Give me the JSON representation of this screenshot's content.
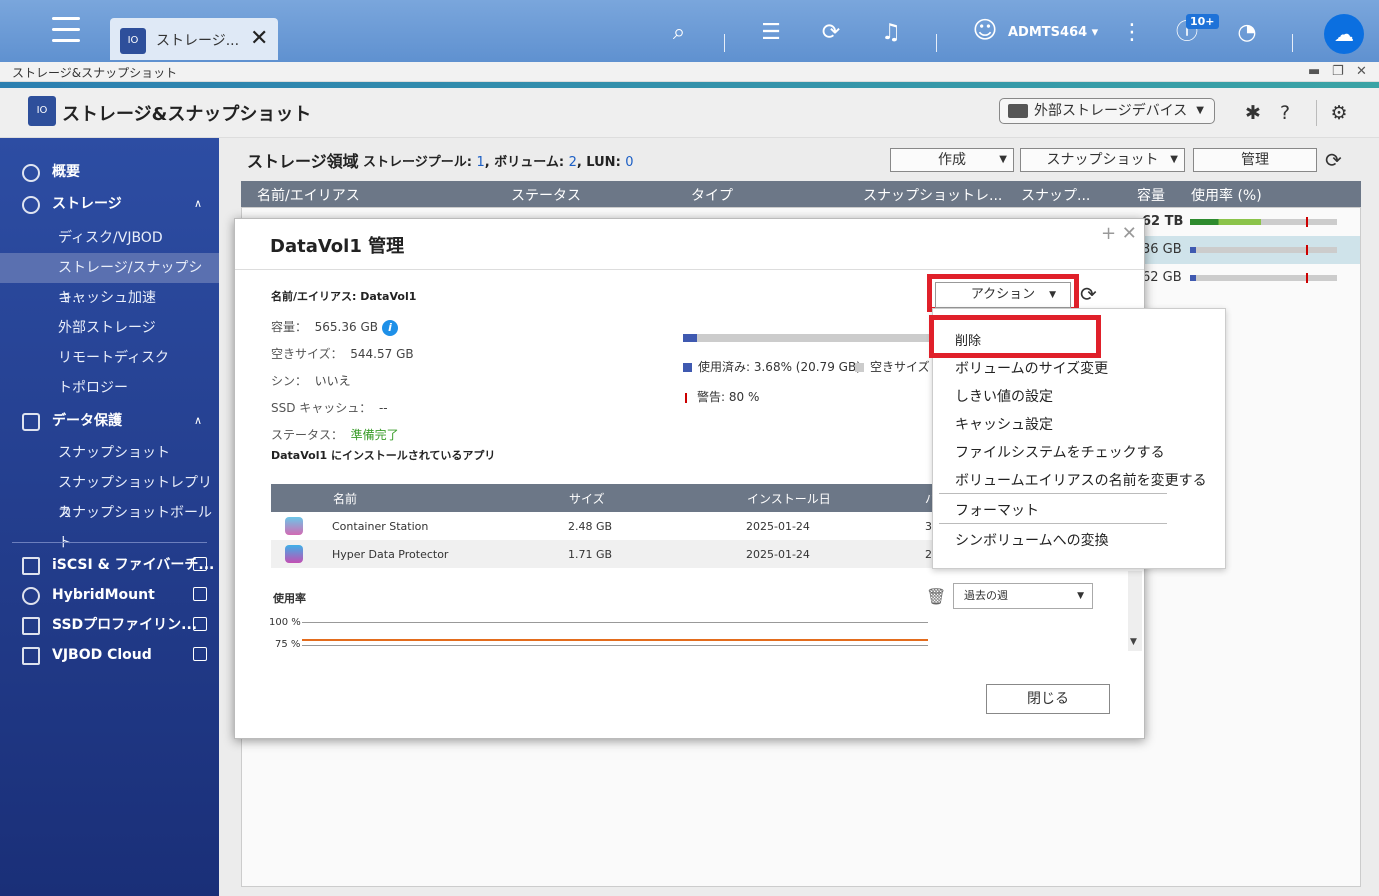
{
  "taskbar": {
    "tab_label": "ストレージ...",
    "tab_close": "✕",
    "username": "ADMTS464 ▾",
    "notification_badge": "10+"
  },
  "window": {
    "title": "ストレージ&スナップショット",
    "minimize": "▬",
    "restore": "❐",
    "close": "✕"
  },
  "header": {
    "app_title": "ストレージ&スナップショット",
    "external_devices": "外部ストレージデバイス"
  },
  "sidebar": {
    "items": [
      {
        "label": "概要"
      },
      {
        "label": "ストレージ"
      },
      {
        "label": "ディスク/VJBOD"
      },
      {
        "label": "ストレージ/スナップショ..."
      },
      {
        "label": "キャッシュ加速"
      },
      {
        "label": "外部ストレージ"
      },
      {
        "label": "リモートディスク"
      },
      {
        "label": "トポロジー"
      },
      {
        "label": "データ保護"
      },
      {
        "label": "スナップショット"
      },
      {
        "label": "スナップショットレプリカ"
      },
      {
        "label": "スナップショットボールト"
      },
      {
        "label": "iSCSI & ファイバーチ..."
      },
      {
        "label": "HybridMount"
      },
      {
        "label": "SSDプロファイリン..."
      },
      {
        "label": "VJBOD Cloud"
      }
    ]
  },
  "main": {
    "title": "ストレージ領域",
    "summary_pool_label": "ストレージプール: ",
    "summary_pool_count": "1",
    "summary_vol_label": ", ボリューム: ",
    "summary_vol_count": "2",
    "summary_lun_label": ", LUN: ",
    "summary_lun_count": "0",
    "create_btn": "作成",
    "snapshot_btn": "スナップショット",
    "manage_btn": "管理",
    "columns": [
      "名前/エイリアス",
      "ステータス",
      "タイプ",
      "スナップショットレ...",
      "スナップ...",
      "容量",
      "使用率 (%)"
    ],
    "rows": [
      {
        "capacity": "62 TB",
        "used_pct": 48
      },
      {
        "capacity": "36 GB",
        "used_pct": 4
      },
      {
        "capacity": "62 GB",
        "used_pct": 4
      }
    ]
  },
  "modal": {
    "title": "DataVol1  管理",
    "name_label": "名前/エイリアス: DataVol1",
    "capacity_label": "容量：",
    "capacity_value": "565.36 GB",
    "free_label": "空きサイズ：",
    "free_value": "544.57 GB",
    "thin_label": "シン：",
    "thin_value": "いいえ",
    "ssd_label": "SSD キャッシュ：",
    "ssd_value": "--",
    "status_label": "ステータス：",
    "status_value": "準備完了",
    "apps_label": "DataVol1 にインストールされているアプリ",
    "action_btn": "アクション",
    "used_pct": 3.68,
    "used_legend": "使用済み: 3.68% (20.79 GB)",
    "free_legend": "空きサイズ",
    "warn_legend": "警告: 80 %",
    "apps_columns": [
      "名前",
      "サイズ",
      "インストール日",
      "バ"
    ],
    "apps": [
      {
        "name": "Container Station",
        "size": "2.48 GB",
        "date": "2025-01-24",
        "ver": "3"
      },
      {
        "name": "Hyper Data Protector",
        "size": "1.71 GB",
        "date": "2025-01-24",
        "ver": "2"
      }
    ],
    "usage_label": "使用率",
    "y_100": "100 %",
    "y_75": "75 %",
    "period": "過去の週",
    "close_btn": "閉じる"
  },
  "dropdown": {
    "items": [
      "削除",
      "ボリュームのサイズ変更",
      "しきい値の設定",
      "キャッシュ設定",
      "ファイルシステムをチェックする",
      "ボリュームエイリアスの名前を変更する",
      "フォーマット",
      "シンボリュームへの変換"
    ]
  },
  "colors": {
    "accent": "#2e4f9b",
    "highlight": "#e0202a",
    "ok": "#3a9d2a",
    "bar_used": "#3f59b0"
  }
}
